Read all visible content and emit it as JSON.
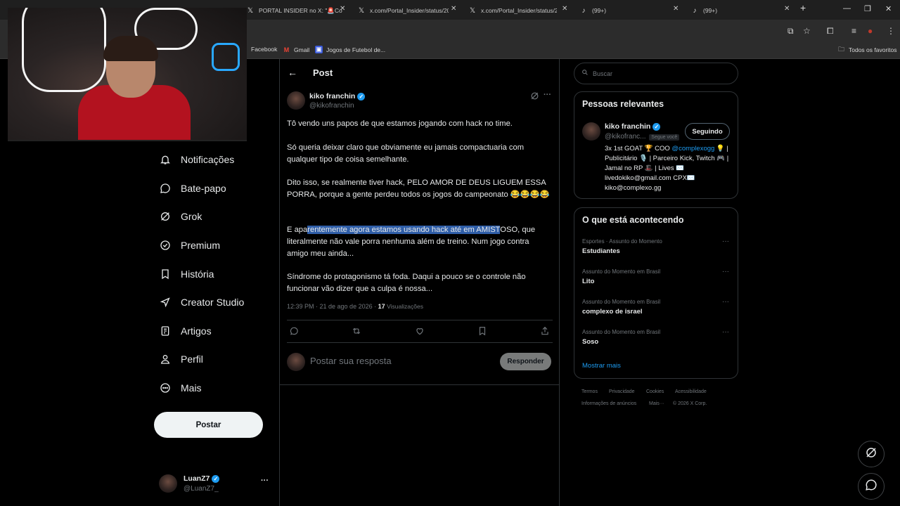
{
  "browser": {
    "tabs": [
      {
        "title": "PORTAL INSIDER no X: \"🚨Co",
        "icon": "x-icon"
      },
      {
        "title": "x.com/Portal_Insider/status/20",
        "icon": "x-icon"
      },
      {
        "title": "x.com/Portal_Insider/status/20",
        "icon": "x-icon"
      },
      {
        "title": "(99+)",
        "icon": "tiktok-icon"
      },
      {
        "title": "(99+)",
        "icon": "tiktok-icon"
      }
    ],
    "new_tab": "+",
    "bookmarks": [
      {
        "label": "Facebook",
        "icon": "facebook-icon"
      },
      {
        "label": "Gmail",
        "icon": "gmail-icon"
      },
      {
        "label": "Jogos de Futebol de...",
        "icon": "bookmark-page-icon"
      }
    ],
    "favorites_label": "Todos os favoritos"
  },
  "nav": {
    "items": [
      {
        "label": "Notificações",
        "icon": "bell-icon"
      },
      {
        "label": "Bate-papo",
        "icon": "chat-icon"
      },
      {
        "label": "Grok",
        "icon": "grok-icon"
      },
      {
        "label": "Premium",
        "icon": "premium-icon"
      },
      {
        "label": "História",
        "icon": "bookmark-icon"
      },
      {
        "label": "Creator Studio",
        "icon": "rocket-icon"
      },
      {
        "label": "Artigos",
        "icon": "article-icon"
      },
      {
        "label": "Perfil",
        "icon": "profile-icon"
      },
      {
        "label": "Mais",
        "icon": "more-circle-icon"
      }
    ],
    "post_button": "Postar",
    "account": {
      "name": "LuanZ7",
      "handle": "@LuanZ7_",
      "menu": "···"
    }
  },
  "post": {
    "header": "Post",
    "author_name": "kiko franchin",
    "author_handle": "@kikofranchin",
    "paragraphs": {
      "p1": "Tô vendo uns papos de que estamos jogando com hack no time.",
      "p2": "Só queria deixar claro que obviamente eu jamais compactuaria com qualquer tipo de coisa semelhante.",
      "p3": "Dito isso, se realmente tiver hack, PELO AMOR DE DEUS LIGUEM ESSA PORRA, porque a gente perdeu todos os jogos do campeonato 😂😂😂😂",
      "p4_before": "E apa",
      "p4_highlight": "rentemente agora estamos usando hack até em AMIST",
      "p4_after": "OSO, que literalmente não vale porra nenhuma além de treino. Num jogo contra amigo meu ainda...",
      "p5": "Síndrome do protagonismo tá foda. Daqui a pouco se o controle não funcionar vão dizer que a culpa é nossa..."
    },
    "timestamp": "12:39 PM · 21 de ago de 2026 · ",
    "views_count": "17",
    "views_label": "Visualizações",
    "reply_placeholder": "Postar sua resposta",
    "reply_button": "Responder"
  },
  "sidebar": {
    "search_placeholder": "Buscar",
    "relevant": {
      "title": "Pessoas relevantes",
      "name": "kiko franchin",
      "handle": "@kikofranc...",
      "follows_you": "Segue você",
      "follow_state": "Seguindo",
      "bio_1": "3x 1st GOAT 🏆 COO ",
      "bio_mention": "@complexogg",
      "bio_2": " 💡 | Publicitário 🎙️ | Parceiro Kick, Twitch 🎮 | Jamal no RP 🎩 | Lives ✉️ livedokiko@gmail.com CPX✉️ kiko@complexo.gg"
    },
    "trends": {
      "title": "O que está acontecendo",
      "items": [
        {
          "category": "Esportes · Assunto do Momento",
          "name": "Estudiantes"
        },
        {
          "category": "Assunto do Momento em Brasil",
          "name": "Lito"
        },
        {
          "category": "Assunto do Momento em Brasil",
          "name": "complexo de israel"
        },
        {
          "category": "Assunto do Momento em Brasil",
          "name": "Soso"
        }
      ],
      "show_more": "Mostrar mais"
    },
    "footer": [
      "Termos",
      "Privacidade",
      "Cookies",
      "Acessibilidade",
      "Informações de anúncios",
      "Mais···",
      "© 2026 X Corp."
    ]
  },
  "colors": {
    "accent": "#1d9bf0",
    "highlight": "#2f5ea8",
    "background": "#000000",
    "border": "#2f3336",
    "muted": "#71767b"
  }
}
